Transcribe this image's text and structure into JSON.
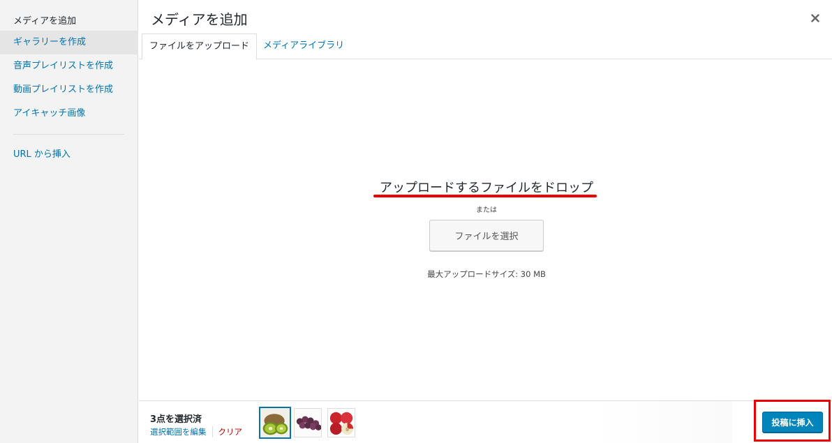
{
  "sidebar": {
    "title": "メディアを追加",
    "items": [
      {
        "label": "ギャラリーを作成"
      },
      {
        "label": "音声プレイリストを作成"
      },
      {
        "label": "動画プレイリストを作成"
      },
      {
        "label": "アイキャッチ画像"
      }
    ],
    "url_insert": "URL から挿入"
  },
  "header": {
    "title": "メディアを追加",
    "close_icon": "close-icon"
  },
  "tabs": [
    {
      "label": "ファイルをアップロード",
      "active": true
    },
    {
      "label": "メディアライブラリ",
      "active": false
    }
  ],
  "uploader": {
    "drop_text": "アップロードするファイルをドロップ",
    "or_text": "または",
    "select_button": "ファイルを選択",
    "max_size": "最大アップロードサイズ: 30 MB"
  },
  "selection": {
    "count_text": "3点を選択済",
    "edit_link": "選択範囲を編集",
    "clear_link": "クリア",
    "thumbnails": [
      {
        "name": "kiwi-thumbnail",
        "selected": true
      },
      {
        "name": "grapes-thumbnail",
        "selected": false
      },
      {
        "name": "apples-thumbnail",
        "selected": false
      }
    ]
  },
  "insert_button": "投稿に挿入",
  "colors": {
    "link": "#0073aa",
    "primary_button": "#0085ba",
    "highlight": "#ee0000",
    "clear": "#aa0000"
  }
}
